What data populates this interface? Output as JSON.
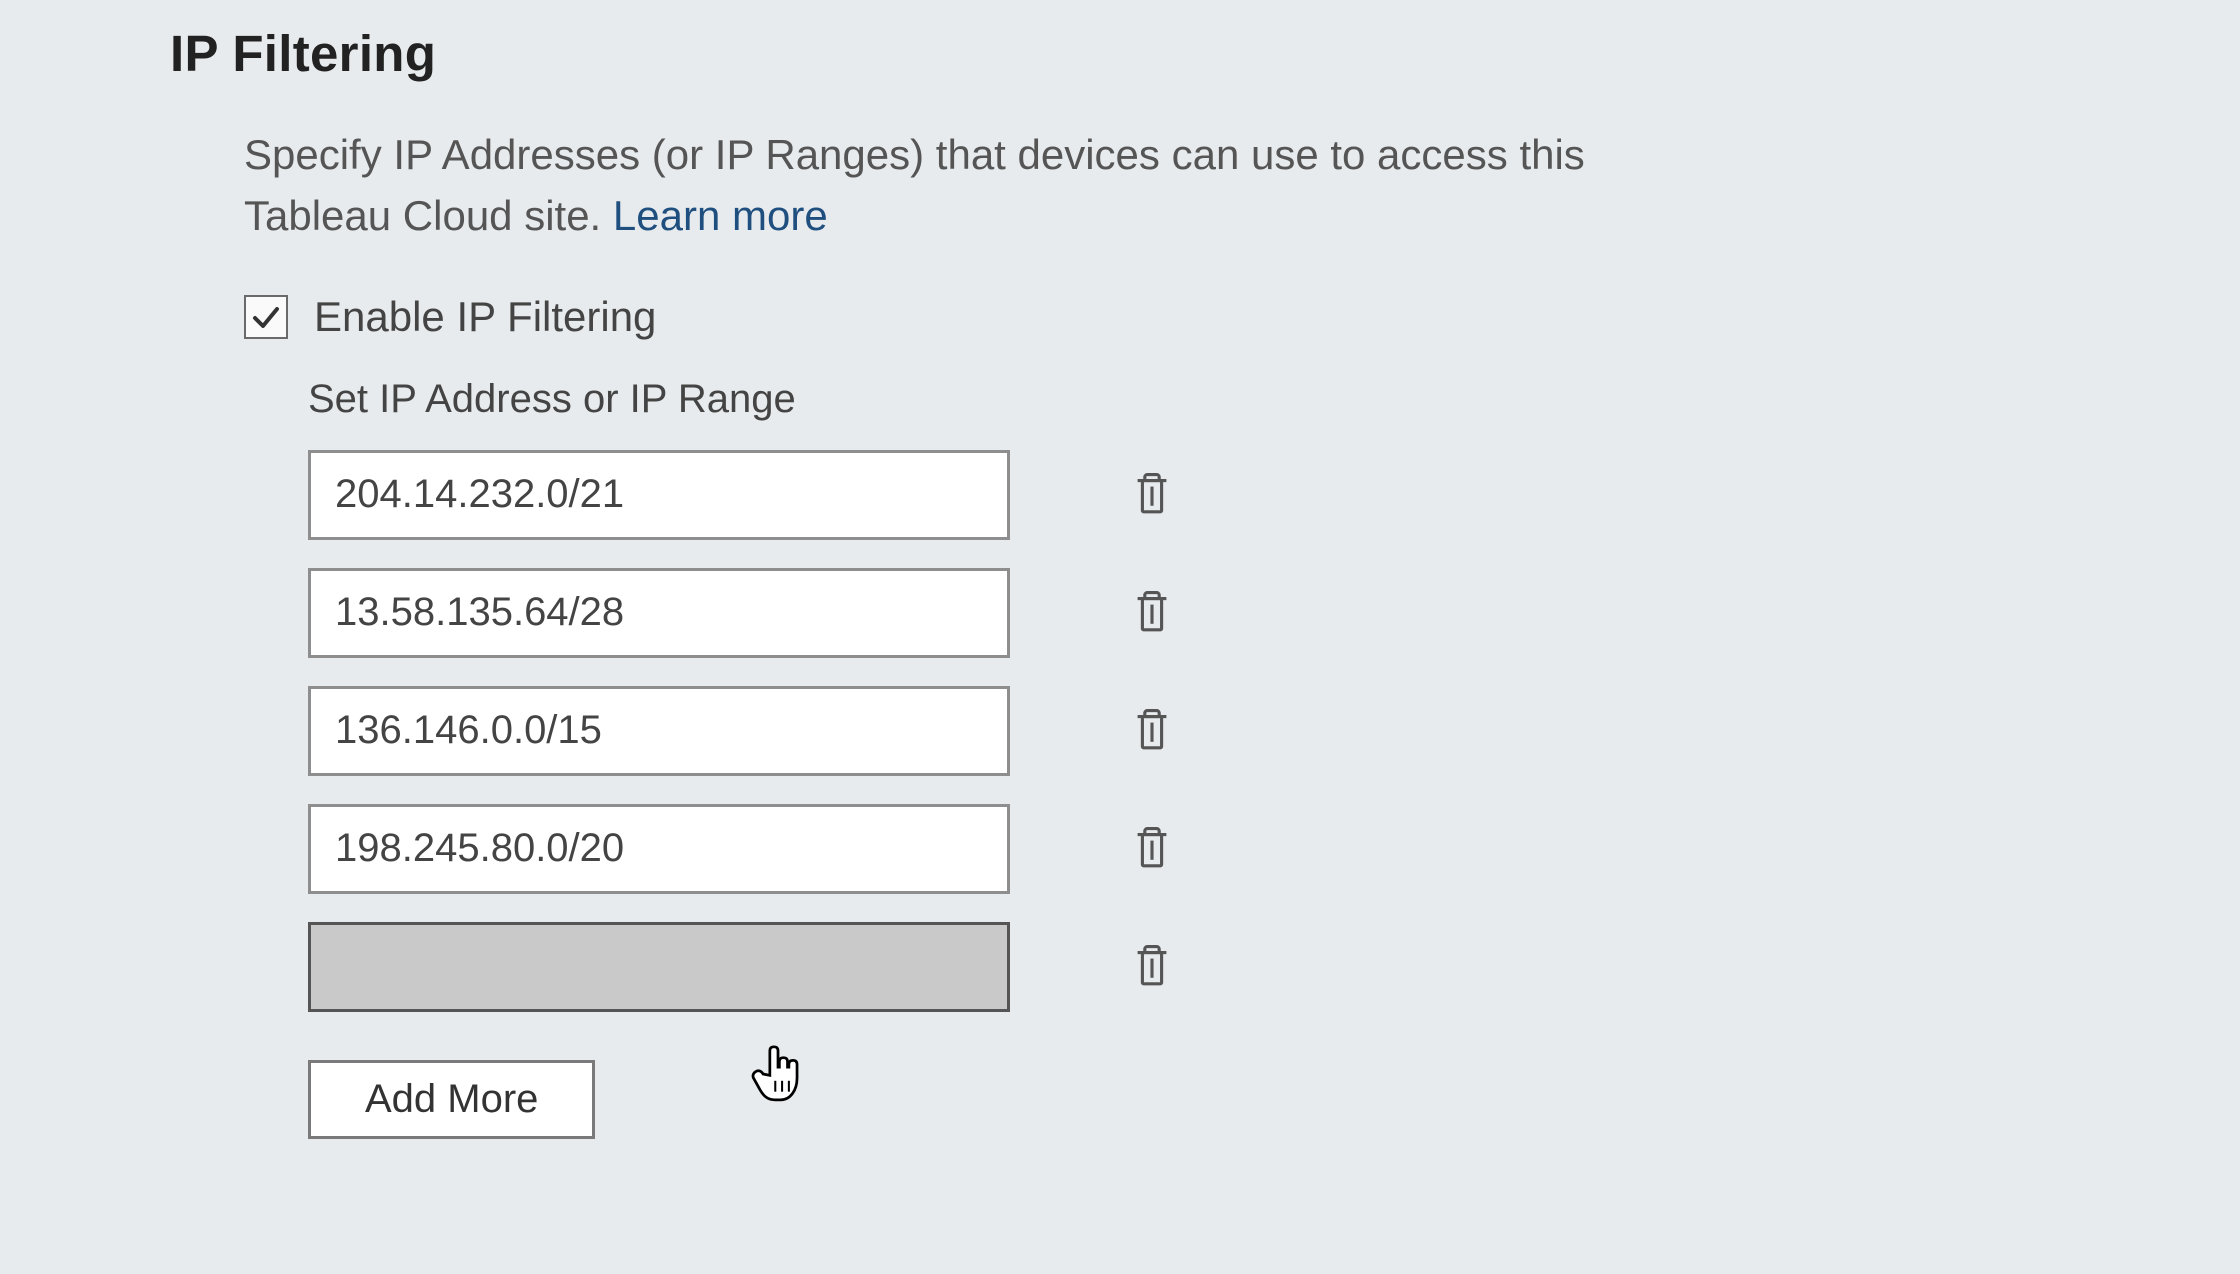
{
  "section": {
    "title": "IP Filtering",
    "description_text": "Specify IP Addresses (or IP Ranges) that devices can use to access this Tableau Cloud site.  ",
    "learn_more": "Learn more"
  },
  "checkbox": {
    "label": "Enable IP Filtering",
    "checked": true
  },
  "sub_label": "Set IP Address or IP Range",
  "ip_rows": [
    {
      "value": "204.14.232.0/21",
      "active": false
    },
    {
      "value": "13.58.135.64/28",
      "active": false
    },
    {
      "value": "136.146.0.0/15",
      "active": false
    },
    {
      "value": "198.245.80.0/20",
      "active": false
    },
    {
      "value": "",
      "active": true
    }
  ],
  "add_more": "Add More",
  "icons": {
    "trash": "trash-icon",
    "check": "check-icon"
  }
}
